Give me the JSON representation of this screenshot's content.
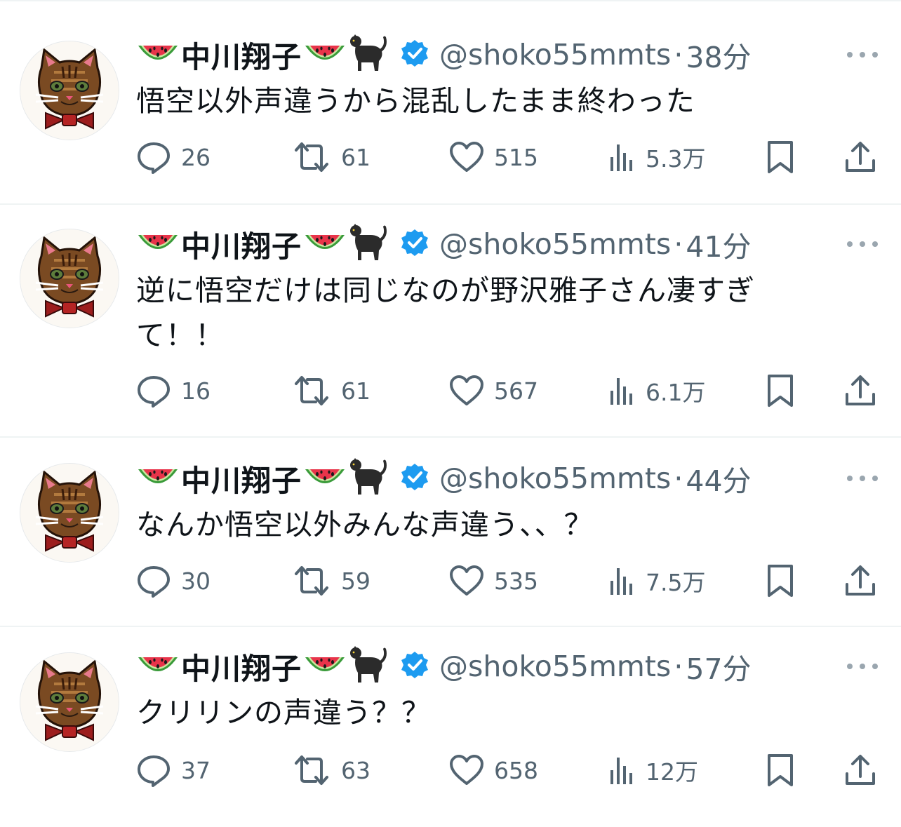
{
  "author": {
    "display_name": "中川翔子",
    "handle": "@shoko55mmts",
    "verified": true,
    "name_emoji_left": "watermelon-icon",
    "name_emoji_right": [
      "watermelon-icon",
      "black-cat-icon"
    ]
  },
  "colors": {
    "verified_badge": "#1d9bf0",
    "secondary_text": "#536471",
    "divider": "#eff3f4"
  },
  "tweets": [
    {
      "separator": "·",
      "time": "38分",
      "text": "悟空以外声違うから混乱したまま終わった",
      "replies": "26",
      "retweets": "61",
      "likes": "515",
      "views": "5.3万"
    },
    {
      "separator": "·",
      "time": "41分",
      "text": "逆に悟空だけは同じなのが野沢雅子さん凄すぎて！！",
      "replies": "16",
      "retweets": "61",
      "likes": "567",
      "views": "6.1万"
    },
    {
      "separator": "·",
      "time": "44分",
      "text": "なんか悟空以外みんな声違う、、？",
      "replies": "30",
      "retweets": "59",
      "likes": "535",
      "views": "7.5万"
    },
    {
      "separator": "·",
      "time": "57分",
      "text": "クリリンの声違う？？",
      "replies": "37",
      "retweets": "63",
      "likes": "658",
      "views": "12万"
    }
  ]
}
